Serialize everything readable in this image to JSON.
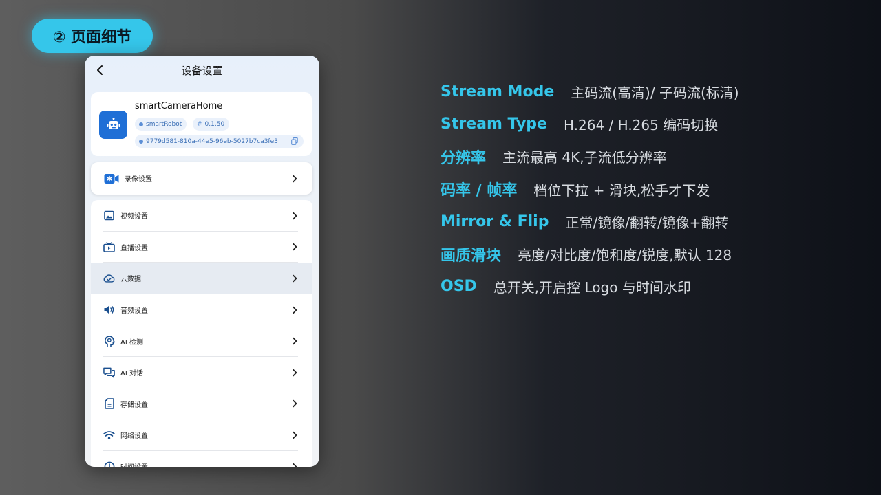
{
  "section_badge": "② 页面细节",
  "phone": {
    "title": "设备设置",
    "device": {
      "name": "smartCameraHome",
      "tag": "smartRobot",
      "version": "0.1.50",
      "id": "9779d581-810a-44e5-96eb-5027b7ca3fe3"
    },
    "record_row": "录像设置",
    "menu": [
      {
        "label": "视频设置",
        "icon": "image-icon"
      },
      {
        "label": "直播设置",
        "icon": "tv-play-icon"
      },
      {
        "label": "云数据",
        "icon": "cloud-check-icon"
      },
      {
        "label": "音频设置",
        "icon": "speaker-icon"
      },
      {
        "label": "AI 检测",
        "icon": "brain-icon"
      },
      {
        "label": "AI 对话",
        "icon": "chat-icon"
      },
      {
        "label": "存储设置",
        "icon": "sd-card-icon"
      },
      {
        "label": "网络设置",
        "icon": "wifi-icon"
      },
      {
        "label": "时间设置",
        "icon": "clock-icon"
      }
    ],
    "highlight_index": 2,
    "colors": {
      "accent": "#1f6fd6",
      "icon": "#1a4f8f"
    }
  },
  "features": [
    {
      "key": "Stream Mode",
      "value": "主码流(高清)/ 子码流(标清)"
    },
    {
      "key": "Stream Type",
      "value": "H.264 / H.265 编码切换"
    },
    {
      "key": "分辨率",
      "value": "主流最高 4K,子流低分辨率"
    },
    {
      "key": "码率 / 帧率",
      "value": "档位下拉 + 滑块,松手才下发"
    },
    {
      "key": "Mirror & Flip",
      "value": "正常/镜像/翻转/镜像+翻转"
    },
    {
      "key": "画质滑块",
      "value": "亮度/对比度/饱和度/锐度,默认 128"
    },
    {
      "key": "OSD",
      "value": "总开关,开启控 Logo 与时间水印"
    }
  ],
  "colors": {
    "feature_key": "#35c6ea",
    "feature_value": "#d7dbe0",
    "badge": "#35c6ea"
  }
}
